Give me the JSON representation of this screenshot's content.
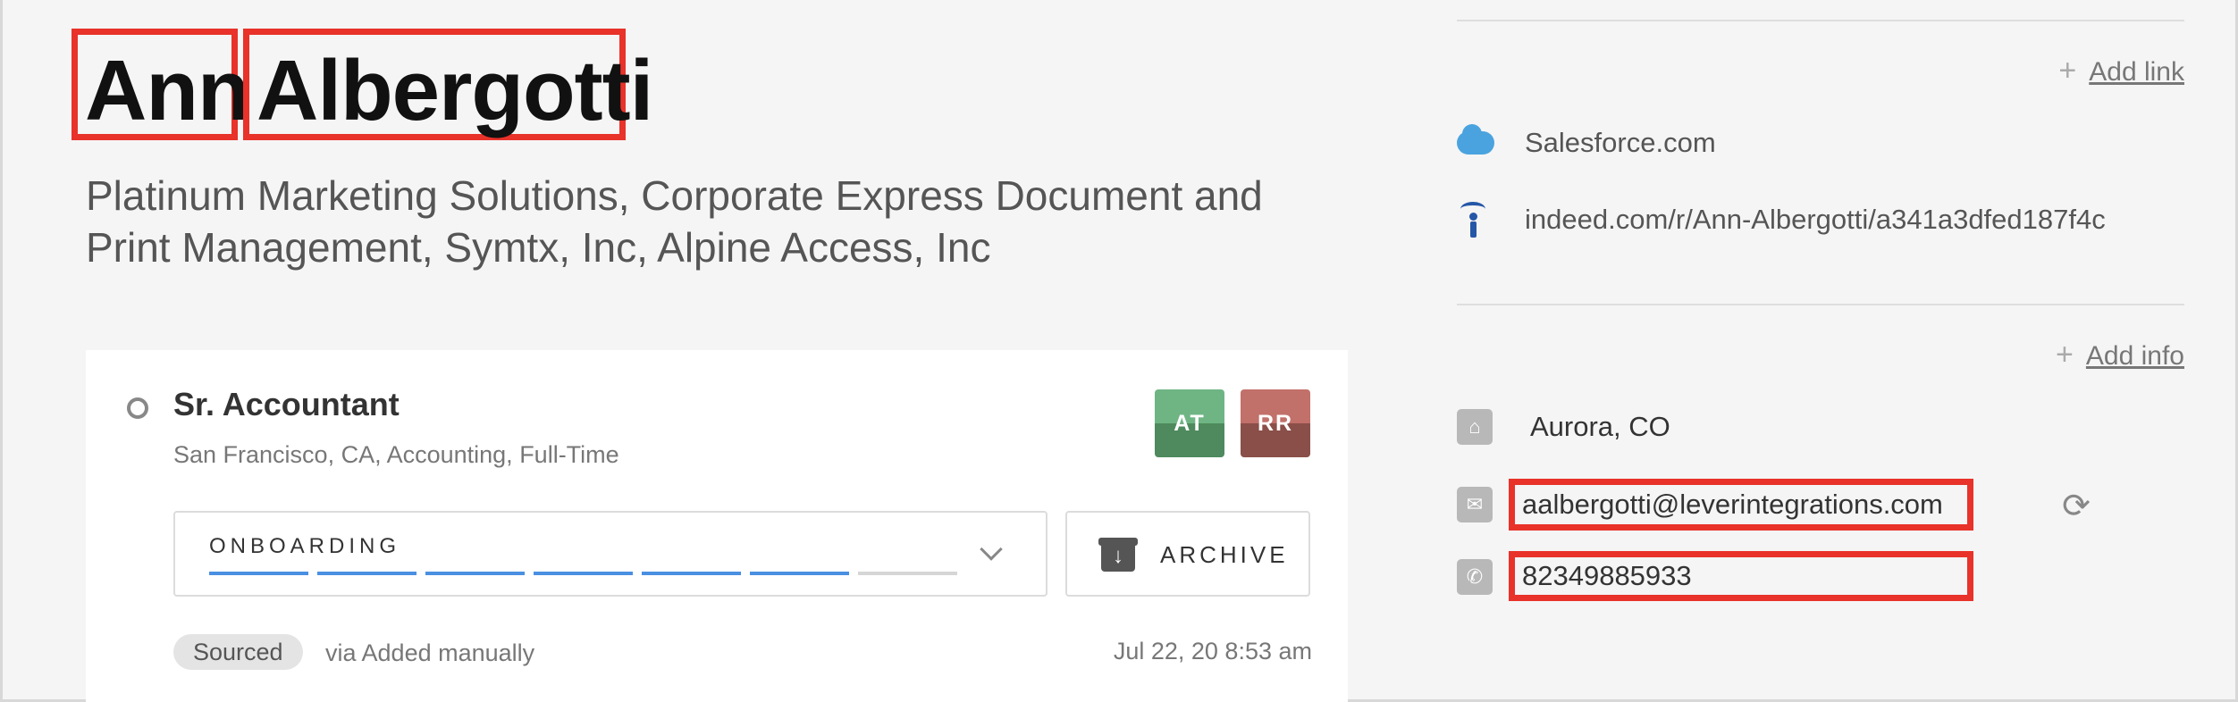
{
  "candidate": {
    "first_name": "Ann",
    "last_name": "Albergotti",
    "headline": "Platinum Marketing Solutions, Corporate Express Document and Print Management, Symtx, Inc, Alpine Access, Inc"
  },
  "opportunity": {
    "job_title": "Sr. Accountant",
    "job_meta": "San Francisco, CA, Accounting, Full-Time",
    "owners": [
      {
        "initials": "AT",
        "color": "#5e9f6f"
      },
      {
        "initials": "RR",
        "color": "#a65f58"
      }
    ],
    "stage": {
      "label": "ONBOARDING",
      "progress_filled": 6,
      "progress_total": 7
    },
    "archive_label": "ARCHIVE",
    "source_badge": "Sourced",
    "source_via": "via Added manually",
    "source_date": "Jul 22, 20 8:53 am"
  },
  "links": {
    "add_label": "Add link",
    "items": [
      {
        "icon": "salesforce-icon",
        "text": "Salesforce.com"
      },
      {
        "icon": "indeed-icon",
        "text": "indeed.com/r/Ann-Albergotti/a341a3dfed187f4c"
      }
    ]
  },
  "info": {
    "add_label": "Add info",
    "location": "Aurora, CO",
    "email": "aalbergotti@leverintegrations.com",
    "phone": "82349885933"
  },
  "colors": {
    "highlight": "#e8322a",
    "progress": "#4a90e2"
  }
}
